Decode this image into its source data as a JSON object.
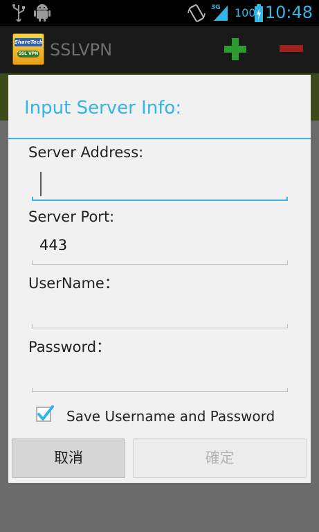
{
  "status_bar": {
    "battery_percent": "100",
    "time": "10:48",
    "network": "3G",
    "icons": [
      "usb-icon",
      "android-debug-icon",
      "screen-rotate-icon",
      "signal-3g-icon",
      "battery-charging-icon"
    ]
  },
  "action_bar": {
    "logo_text_top": "ShareTech",
    "logo_text_bottom": "SSL VPN",
    "title": "SSLVPN",
    "icons": [
      "add-icon",
      "remove-icon"
    ]
  },
  "dialog": {
    "title": "Input Server Info:",
    "fields": [
      {
        "label": "Server Address:",
        "value": "",
        "focused": true
      },
      {
        "label": "Server Port:",
        "value": "443",
        "focused": false
      },
      {
        "label": "UserName：",
        "value": "",
        "focused": false
      },
      {
        "label": "Password：",
        "value": "",
        "focused": false
      }
    ],
    "save_checkbox": {
      "label": "Save Username and Password",
      "checked": true
    },
    "buttons": {
      "cancel": "取消",
      "confirm": "確定"
    }
  },
  "colors": {
    "accent": "#33b5e5",
    "add_green": "#2e9b2e",
    "remove_red": "#a02020"
  }
}
